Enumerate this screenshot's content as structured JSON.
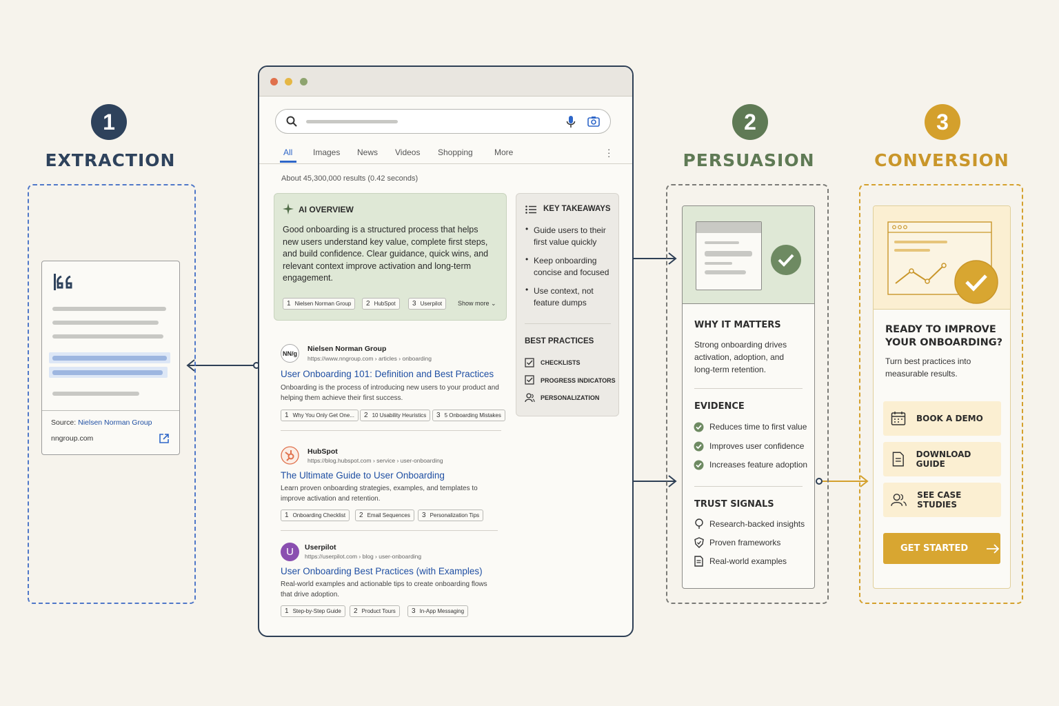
{
  "colors": {
    "extraction": "#2e425c",
    "persuasion": "#5f7a55",
    "conversion": "#d4a02c",
    "dash_blue": "#4f77c8",
    "link": "#1f4fa3"
  },
  "stages": [
    {
      "number": "1",
      "title": "EXTRACTION"
    },
    {
      "number": "2",
      "title": "PERSUASION"
    },
    {
      "number": "3",
      "title": "CONVERSION"
    }
  ],
  "extraction": {
    "source_label": "Source:",
    "source_name": "Nielsen Norman Group",
    "domain": "nngroup.com",
    "quote_icon": "quote-icon",
    "open_icon": "external-link-icon"
  },
  "browser": {
    "tabs": [
      "All",
      "Images",
      "News",
      "Videos",
      "Shopping",
      "More"
    ],
    "results_count": "About 45,300,000 results (0.42 seconds)",
    "ai_overview": {
      "title": "AI OVERVIEW",
      "text": "Good onboarding is a structured process that helps new users understand key value, complete first steps, and build confidence. Clear guidance, quick wins, and relevant context improve activation and long-term engagement.",
      "sources": [
        {
          "n": "1",
          "label": "Nielsen Norman Group"
        },
        {
          "n": "2",
          "label": "HubSpot"
        },
        {
          "n": "3",
          "label": "Userpilot"
        }
      ],
      "show_more": "Show more"
    },
    "key_takeaways": {
      "title": "KEY TAKEAWAYS",
      "items": [
        "Guide users to their first value quickly",
        "Keep onboarding concise and focused",
        "Use context, not feature dumps"
      ]
    },
    "best_practices": {
      "title": "BEST PRACTICES",
      "items": [
        "CHECKLISTS",
        "PROGRESS INDICATORS",
        "PERSONALIZATION"
      ]
    },
    "results": [
      {
        "site": "Nielsen Norman Group",
        "url": "https://www.nngroup.com › articles › onboarding",
        "title": "User Onboarding 101: Definition and Best Practices",
        "desc": "Onboarding is the process of introducing new users to your product and helping them achieve their first success.",
        "chips": [
          {
            "n": "1",
            "label": "Why You Only Get One..."
          },
          {
            "n": "2",
            "label": "10 Usability Heuristics"
          },
          {
            "n": "3",
            "label": "5 Onboarding Mistakes"
          }
        ],
        "favicon": "NN/g"
      },
      {
        "site": "HubSpot",
        "url": "https://blog.hubspot.com › service › user-onboarding",
        "title": "The Ultimate Guide to User Onboarding",
        "desc": "Learn proven onboarding strategies, examples, and templates to improve activation and retention.",
        "chips": [
          {
            "n": "1",
            "label": "Onboarding Checklist"
          },
          {
            "n": "2",
            "label": "Email Sequences"
          },
          {
            "n": "3",
            "label": "Personalization Tips"
          }
        ],
        "favicon": "hubspot-icon"
      },
      {
        "site": "Userpilot",
        "url": "https://userpilot.com › blog › user-onboarding",
        "title": "User Onboarding Best Practices (with Examples)",
        "desc": "Real-world examples and actionable tips to create onboarding flows that drive adoption.",
        "chips": [
          {
            "n": "1",
            "label": "Step-by-Step Guide"
          },
          {
            "n": "2",
            "label": "Product Tours"
          },
          {
            "n": "3",
            "label": "In-App Messaging"
          }
        ],
        "favicon": "U"
      }
    ]
  },
  "persuasion": {
    "why_title": "WHY IT MATTERS",
    "why_text": "Strong onboarding drives activation, adoption, and long-term retention.",
    "evidence_title": "EVIDENCE",
    "evidence": [
      "Reduces time to first value",
      "Improves user confidence",
      "Increases feature adoption"
    ],
    "trust_title": "TRUST SIGNALS",
    "trust": [
      "Research-backed insights",
      "Proven frameworks",
      "Real-world examples"
    ]
  },
  "conversion": {
    "heading": "READY TO IMPROVE YOUR ONBOARDING?",
    "sub": "Turn best practices into measurable results.",
    "buttons": [
      "BOOK A DEMO",
      "DOWNLOAD GUIDE",
      "SEE CASE STUDIES"
    ],
    "cta": "GET STARTED"
  }
}
